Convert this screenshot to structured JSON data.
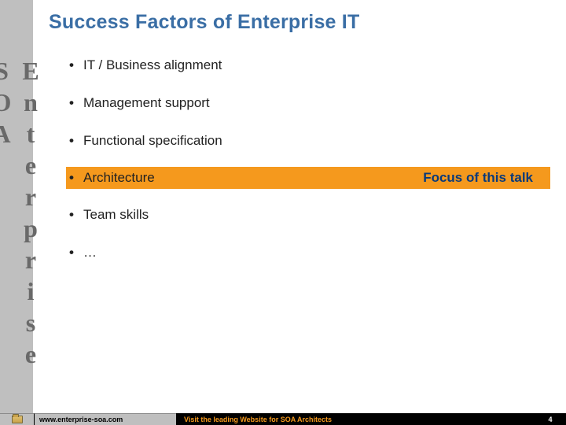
{
  "title": "Success Factors of Enterprise IT",
  "side_text": "Enterprise SOA",
  "bullets": [
    {
      "text": "IT / Business alignment",
      "highlight": false
    },
    {
      "text": "Management support",
      "highlight": false
    },
    {
      "text": "Functional specification",
      "highlight": false
    },
    {
      "text": "Architecture",
      "highlight": true,
      "focus": "Focus of this talk"
    },
    {
      "text": "Team skills",
      "highlight": false
    },
    {
      "text": "…",
      "highlight": false
    }
  ],
  "footer": {
    "url": "www.enterprise-soa.com",
    "visit": "Visit the leading Website for SOA Architects",
    "page": "4"
  }
}
